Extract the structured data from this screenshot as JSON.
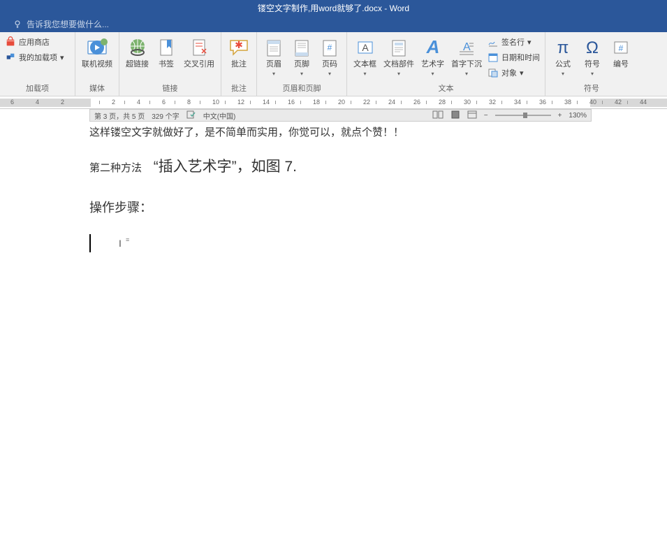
{
  "title": "镂空文字制作,用word就够了.docx - Word",
  "tellme": "告诉我您想要做什么...",
  "ribbon": {
    "addins_group": "加载项",
    "app_store": "应用商店",
    "my_addins": "我的加载项",
    "media_group": "媒体",
    "online_video": "联机视频",
    "links_group": "链接",
    "hyperlink": "超链接",
    "bookmark": "书签",
    "crossref": "交叉引用",
    "comments_group": "批注",
    "comment": "批注",
    "headerfooter_group": "页眉和页脚",
    "header": "页眉",
    "footer": "页脚",
    "pagenum": "页码",
    "text_group": "文本",
    "textbox": "文本框",
    "quickparts": "文档部件",
    "wordart": "艺术字",
    "dropcap": "首字下沉",
    "sigline": "签名行",
    "datetime": "日期和时间",
    "object": "对象",
    "symbols_group": "符号",
    "equation": "公式",
    "symbol": "符号",
    "number": "编号"
  },
  "status": {
    "page": "第 3 页，共 5 页",
    "words": "329 个字",
    "lang": "中文(中国)",
    "zoom": "130%"
  },
  "doc": {
    "p1": "这样镂空文字就做好了，是不简单而实用，你觉可以，就点个赞！！",
    "p2a": "第二种方法",
    "p2b": "“插入艺术字”，如图 7.",
    "p3": "操作步骤："
  },
  "ruler_left": [
    "6",
    "4",
    "2"
  ],
  "ruler_nums": [
    "2",
    "4",
    "6",
    "8",
    "10",
    "12",
    "14",
    "16",
    "18",
    "20",
    "22",
    "24",
    "26",
    "28",
    "30",
    "32",
    "34",
    "36",
    "38",
    "40",
    "42",
    "44"
  ]
}
